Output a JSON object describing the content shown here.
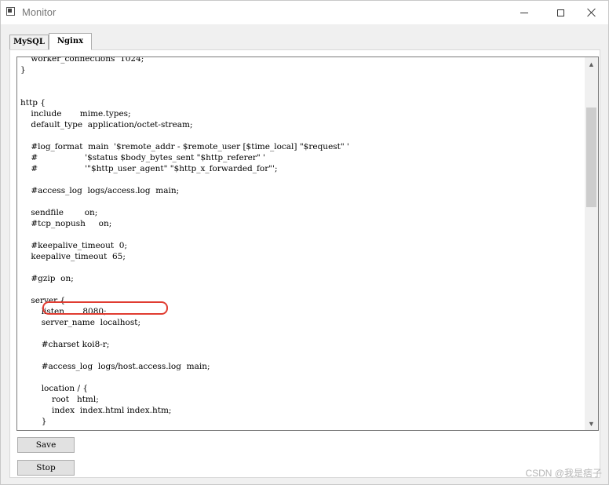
{
  "window": {
    "title": "Monitor",
    "minimize_label": "—",
    "maximize_label": "☐",
    "close_label": "✕"
  },
  "tabs": [
    {
      "label": "MySQL",
      "selected": false
    },
    {
      "label": "Nginx",
      "selected": true
    }
  ],
  "editor": {
    "lines": [
      "    worker_connections  1024;",
      "}",
      "",
      "",
      "http {",
      "    include       mime.types;",
      "    default_type  application/octet-stream;",
      "",
      "    #log_format  main  '$remote_addr - $remote_user [$time_local] \"$request\" '",
      "    #                  '$status $body_bytes_sent \"$http_referer\" '",
      "    #                  '\"$http_user_agent\" \"$http_x_forwarded_for\"';",
      "",
      "    #access_log  logs/access.log  main;",
      "",
      "    sendfile        on;",
      "    #tcp_nopush     on;",
      "",
      "    #keepalive_timeout  0;",
      "    keepalive_timeout  65;",
      "",
      "    #gzip  on;",
      "",
      "    server {",
      "        listen       8080;",
      "        server_name  localhost;",
      "",
      "        #charset koi8-r;",
      "",
      "        #access_log  logs/host.access.log  main;",
      "",
      "        location / {",
      "            root   html;",
      "            index  index.html index.htm;",
      "        }"
    ]
  },
  "buttons": {
    "save_label": "Save",
    "stop_label": "Stop"
  },
  "watermark": "CSDN @我是痞子",
  "colors": {
    "highlight": "#e03c31"
  }
}
